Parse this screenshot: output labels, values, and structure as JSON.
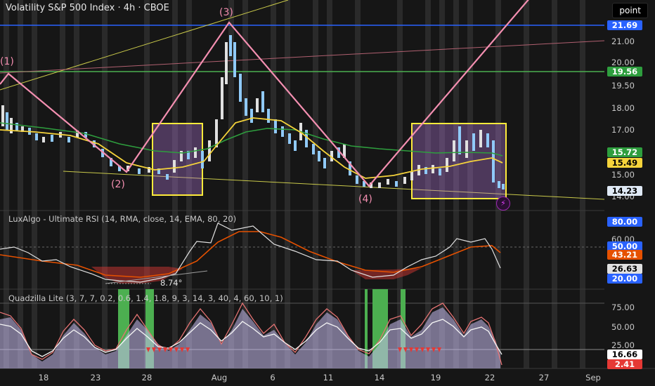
{
  "header": {
    "symbol_title": "Volatility S&P 500 Index · 4h · CBOE"
  },
  "toolbar": {
    "point_label": "point"
  },
  "panels": {
    "rsi_title": "LuxAlgo - Ultimate RSI (14, RMA, close, 14, EMA, 80, 20)",
    "quad_title": "Quadzilla Lite (3, 7, 7, 0.2, 0.6, 1.4, 1.8, 9, 3, 14, 3, 40, 4, 60, 10, 1)"
  },
  "waves": [
    "(1)",
    "(2)",
    "(3)",
    "(4)"
  ],
  "annotation": {
    "angle": "8.74°"
  },
  "price_axis": {
    "labels": [
      "21.00",
      "20.00",
      "19.50",
      "18.00",
      "17.00",
      "15.00",
      "14.00"
    ]
  },
  "rsi_axis": {
    "labels": [
      "60.00"
    ]
  },
  "quad_axis": {
    "labels": [
      "75.00",
      "50.00",
      "25.00"
    ]
  },
  "badges": {
    "price_top": "21.69",
    "price_green": "19.56",
    "ma_green": "15.72",
    "ma_yellow": "15.49",
    "last": "14.23",
    "rsi_high": "80.00",
    "rsi_mid": "50.00",
    "rsi_signal": "43.21",
    "rsi_value": "26.63",
    "rsi_low": "20.00",
    "quad_a": "16.66",
    "quad_b": "2.41"
  },
  "time_axis": {
    "labels": [
      "18",
      "23",
      "28",
      "Aug",
      "6",
      "11",
      "14",
      "19",
      "22",
      "27",
      "Sep"
    ]
  },
  "colors": {
    "background": "#161616",
    "candle_up": "#e0e0e0",
    "candle_down": "#90caf9",
    "wave_pink": "#f48fb1",
    "box_yellow": "#ffeb3b",
    "ma_yellow": "#f5d33b",
    "ma_green": "#2e9e3e",
    "badge_blue": "#2962ff",
    "badge_green": "#2e9e3e",
    "badge_red": "#e53935"
  }
}
